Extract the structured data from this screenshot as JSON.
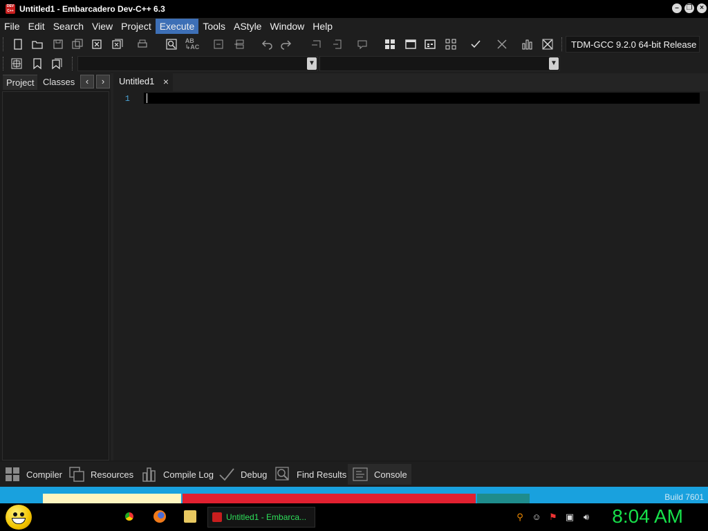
{
  "window": {
    "title": "Untitled1 - Embarcadero Dev-C++ 6.3",
    "app_icon_text": "DEV C++"
  },
  "menu": {
    "items": [
      "File",
      "Edit",
      "Search",
      "View",
      "Project",
      "Execute",
      "Tools",
      "AStyle",
      "Window",
      "Help"
    ],
    "active": "Execute"
  },
  "toolbar": {
    "compiler": "TDM-GCC 9.2.0 64-bit Release"
  },
  "left_panel": {
    "tabs": [
      "Project",
      "Classes"
    ],
    "active_tab": "Project",
    "nav_prev": "‹",
    "nav_next": "›"
  },
  "editor": {
    "tabs": [
      {
        "label": "Untitled1",
        "close": "×"
      }
    ],
    "line_numbers": [
      "1"
    ],
    "content": ""
  },
  "bottom_tabs": [
    "Compiler",
    "Resources",
    "Compile Log",
    "Debug",
    "Find Results",
    "Console"
  ],
  "desktop": {
    "build_text": "Build 7601",
    "build_text_partial": "7"
  },
  "taskbar": {
    "task_label": "Untitled1 - Embarca...",
    "clock": "8:04 AM"
  },
  "colors": {
    "background": "#1b1b1b",
    "menu_highlight": "#3d6fb6",
    "line_number": "#4aa3d6",
    "clock": "#17e04a",
    "task_label": "#2ee05a"
  }
}
